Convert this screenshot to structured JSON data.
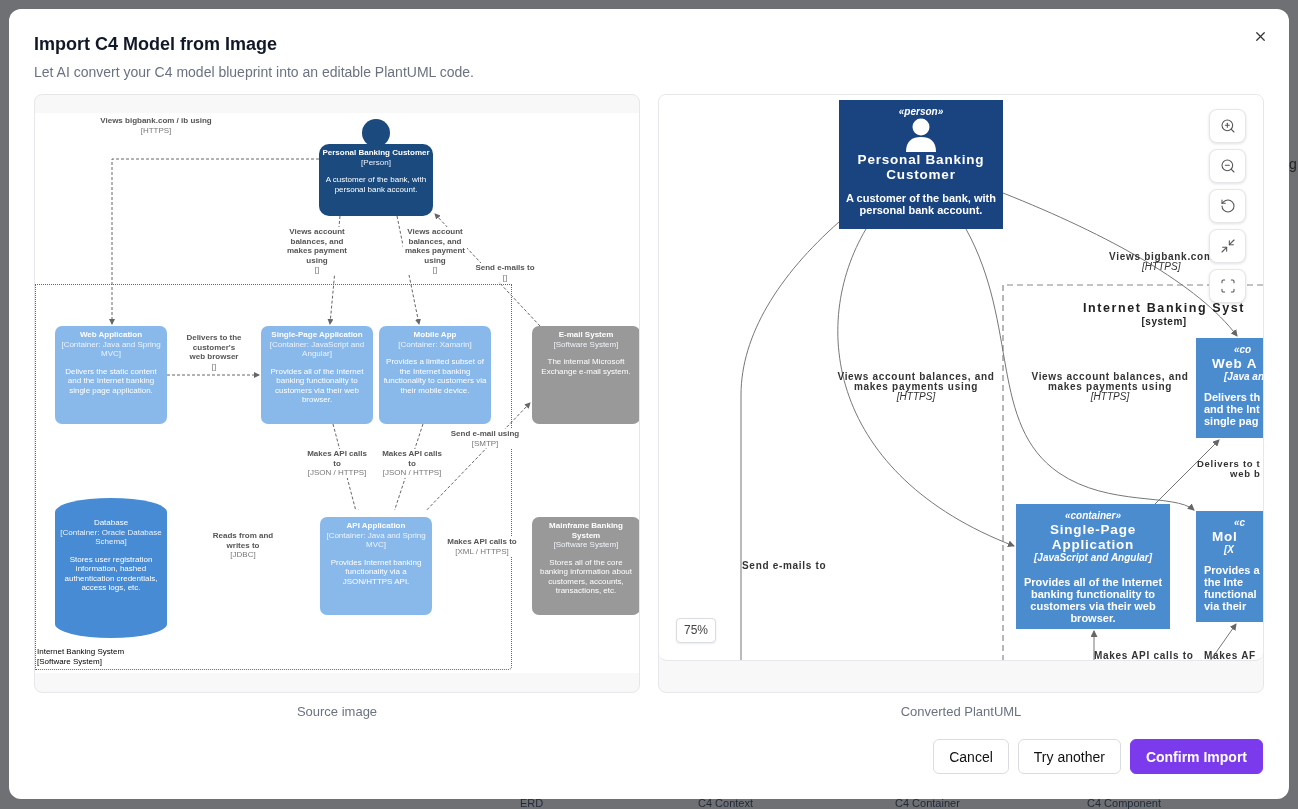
{
  "backdrop": {
    "tabs": [
      "ERD",
      "C4 Context",
      "C4 Container",
      "C4 Component"
    ],
    "fragment": "g"
  },
  "dialog": {
    "title": "Import C4 Model from Image",
    "subtitle": "Let AI convert your C4 model blueprint into an editable PlantUML code."
  },
  "source": {
    "caption": "Source image",
    "boundary": {
      "title": "Internet Banking System",
      "type": "[Software System]"
    },
    "nodes": [
      {
        "kind": "person",
        "title": "Personal Banking Customer",
        "tech": "[Person]",
        "description": "A customer of the bank, with personal bank account."
      },
      {
        "kind": "container",
        "title": "Web Application",
        "tech": "[Container: Java and Spring MVC]",
        "description": "Delivers the static content and the Internet banking single page application."
      },
      {
        "kind": "container",
        "title": "Single-Page Application",
        "tech": "[Container: JavaScript and Angular]",
        "description": "Provides all of the Internet banking functionality to customers via their web browser."
      },
      {
        "kind": "container",
        "title": "Mobile App",
        "tech": "[Container: Xamarin]",
        "description": "Provides a limited subset of the Internet banking functionality to customers via their mobile device."
      },
      {
        "kind": "system",
        "title": "E-mail System",
        "tech": "[Software System]",
        "description": "The internal Microsoft Exchange e-mail system."
      },
      {
        "kind": "database",
        "title": "Database",
        "tech": "[Container: Oracle Database Schema]",
        "description": "Stores user registration information, hashed authentication credentials, access logs, etc."
      },
      {
        "kind": "container",
        "title": "API Application",
        "tech": "[Container: Java and Spring MVC]",
        "description": "Provides Internet banking functionality via a JSON/HTTPS API."
      },
      {
        "kind": "system",
        "title": "Mainframe Banking System",
        "tech": "[Software System]",
        "description": "Stores all of the core banking information about customers, accounts, transactions, etc."
      }
    ],
    "edges": [
      {
        "label": "Views bigbank.com / ib using",
        "tech": "[HTTPS]"
      },
      {
        "label": "Views account balances, and makes payment using",
        "tech": "[]"
      },
      {
        "label": "Views account balances, and makes payment using",
        "tech": "[]"
      },
      {
        "label": "Send e-mails to",
        "tech": "[]"
      },
      {
        "label": "Delivers to the customer's web browser",
        "tech": "[]"
      },
      {
        "label": "Makes API calls to",
        "tech": "[JSON / HTTPS]"
      },
      {
        "label": "Makes API calls to",
        "tech": "[JSON / HTTPS]"
      },
      {
        "label": "Send e-mail using",
        "tech": "[SMTP]"
      },
      {
        "label": "Reads from and writes to",
        "tech": "[JDBC]"
      },
      {
        "label": "Makes API calls to",
        "tech": "[XML / HTTPS]"
      }
    ]
  },
  "converted": {
    "caption": "Converted PlantUML",
    "zoom_level": "75%",
    "boundary": {
      "title": "Internet Banking Syst",
      "type": "[system]"
    },
    "nodes": [
      {
        "kind": "person",
        "stereotype": "«person»",
        "title": "Personal Banking Customer",
        "description": "A customer of the bank, with personal bank account."
      },
      {
        "kind": "clipped",
        "stereotype": "«co",
        "title": "Web A",
        "tech": "[Java an",
        "lines": [
          "Delivers th",
          "and the Int",
          "single pag"
        ]
      },
      {
        "kind": "container",
        "stereotype": "«container»",
        "title": "Single-Page Application",
        "tech": "[JavaScript and Angular]",
        "description": "Provides all of the Internet banking functionality to customers via their web browser."
      },
      {
        "kind": "clipped",
        "stereotype": "«c",
        "title": "Mol",
        "tech": "[X",
        "lines": [
          "Provides a",
          "the Inte",
          "functional",
          "via their"
        ]
      }
    ],
    "edges": [
      {
        "label": "Views bigbank.com",
        "tech": "[HTTPS]"
      },
      {
        "label": "Views account balances, and makes payments using",
        "tech": "[HTTPS]"
      },
      {
        "label": "Views account balances, and makes payments using",
        "tech": "[HTTPS]"
      },
      {
        "label": "Send e-mails to"
      },
      {
        "label": "Delivers to t",
        "tech": "web b"
      },
      {
        "label": "Makes API calls to"
      },
      {
        "label": "Makes AF"
      }
    ]
  },
  "buttons": [
    {
      "label": "Cancel",
      "kind": "secondary"
    },
    {
      "label": "Try another",
      "kind": "secondary"
    },
    {
      "label": "Confirm Import",
      "kind": "primary"
    }
  ]
}
